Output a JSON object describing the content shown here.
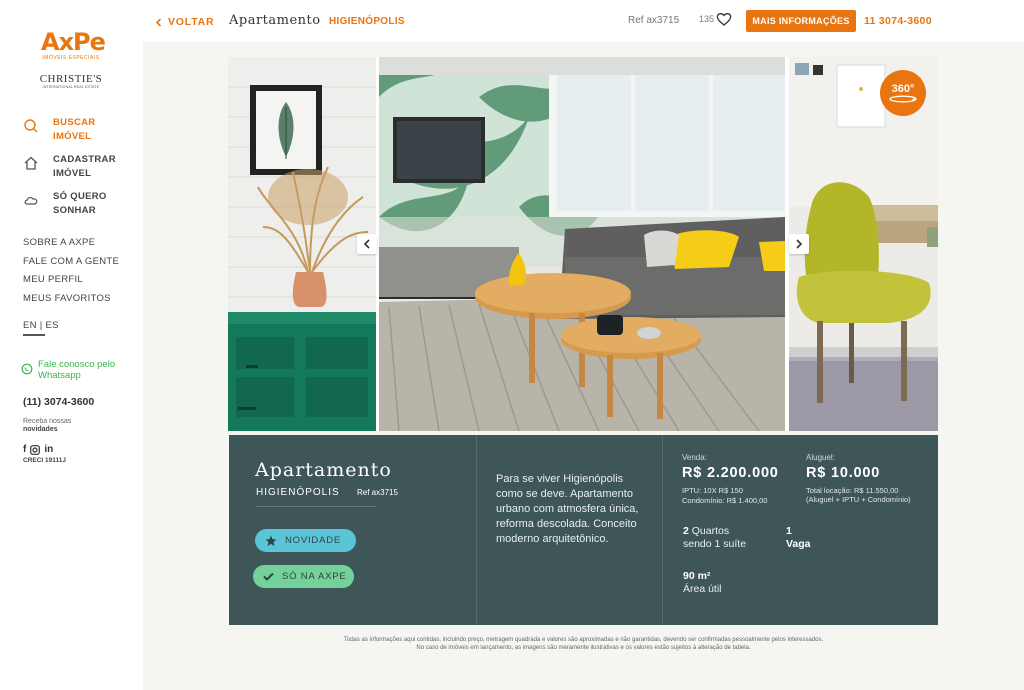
{
  "brand": {
    "logo": "AxPe",
    "logo_sub": "IMÓVEIS ESPECIAIS",
    "partner": "CHRISTIE'S",
    "partner_sub": "INTERNATIONAL REAL ESTATE",
    "accent": "#e8750f"
  },
  "sidebar": {
    "nav": [
      {
        "label": "BUSCAR IMÓVEL",
        "icon": "search-icon",
        "active": true
      },
      {
        "label": "CADASTRAR IMÓVEL",
        "icon": "home-icon",
        "active": false
      },
      {
        "label": "SÓ QUERO SONHAR",
        "icon": "cloud-icon",
        "active": false
      }
    ],
    "links": [
      "SOBRE A AXPE",
      "FALE COM A GENTE",
      "MEU PERFIL",
      "MEUS FAVORITOS"
    ],
    "language": "EN | ES",
    "whatsapp": "Fale conosco pelo Whatsapp",
    "phone": "(11) 3074-3600",
    "newsletter_line1": "Receba nossas",
    "newsletter_line2": "novidades",
    "social_linkedin": "in",
    "creci": "CRECI 19111J"
  },
  "topbar": {
    "back": "VOLTAR",
    "title": "Apartamento",
    "neighborhood": "HIGIENÓPOLIS",
    "ref": "Ref ax3715",
    "likes": "135",
    "more_info": "MAIS INFORMAÇÕES",
    "phone": "11 3074-3600"
  },
  "gallery": {
    "badge": "360°"
  },
  "listing": {
    "title": "Apartamento",
    "neighborhood": "HIGIENÓPOLIS",
    "ref": "Ref ax3715",
    "tags": [
      "NOVIDADE",
      "SÓ NA AXPE"
    ],
    "description": "Para se viver Higienópolis como se deve. Apartamento urbano com atmosfera única, reforma descolada. Conceito moderno arquitetônico.",
    "sale_label": "Venda:",
    "sale_price": "R$ 2.200.000",
    "iptu": "IPTU: 10X R$ 150",
    "condo": "Condomínio: R$ 1.400,00",
    "rent_label": "Aluguel:",
    "rent_price": "R$ 10.000",
    "rent_total": "Total locação: R$ 11.550,00",
    "rent_total_note": "(Aluguel + IPTU + Condomínio)",
    "rooms_num": "2",
    "rooms_label": "Quartos",
    "rooms_sub": "sendo 1 suíte",
    "parking_num": "1",
    "parking_label": "Vaga",
    "area": "90 m²",
    "area_label": "Área útil"
  },
  "disclaimer": {
    "line1": "Todas as informações aqui contidas, incluindo preço, metragem quadrada e valores são aproximadas e não garantidas, devendo ser confirmadas pessoalmente pelos interessados.",
    "line2": "No caso de imóveis em lançamento, as imagens são meramente ilustrativas e os valores estão sujeitos à alteração de tabela."
  }
}
